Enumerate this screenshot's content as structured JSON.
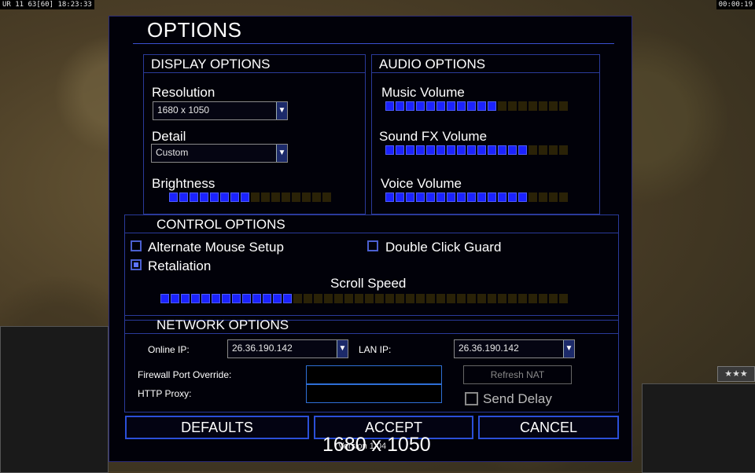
{
  "hud": {
    "top_left": "UR 11 63[60] 18:23:33",
    "top_right": "00:00:19"
  },
  "rank_stars": "★★★",
  "dialog": {
    "title": "OPTIONS"
  },
  "display": {
    "header": "DISPLAY OPTIONS",
    "resolution_label": "Resolution",
    "resolution_value": "1680 x 1050",
    "detail_label": "Detail",
    "detail_value": "Custom",
    "brightness_label": "Brightness",
    "brightness_level": 0.5
  },
  "audio": {
    "header": "AUDIO OPTIONS",
    "music_label": "Music Volume",
    "music_level": 0.6,
    "sfx_label": "Sound FX Volume",
    "sfx_level": 0.8,
    "voice_label": "Voice Volume",
    "voice_level": 0.8
  },
  "control": {
    "header": "CONTROL OPTIONS",
    "alt_mouse_label": "Alternate Mouse Setup",
    "alt_mouse_checked": false,
    "double_click_label": "Double Click Guard",
    "double_click_checked": false,
    "retaliation_label": "Retaliation",
    "retaliation_checked": true,
    "scroll_label": "Scroll Speed",
    "scroll_level": 0.33
  },
  "network": {
    "header": "NETWORK OPTIONS",
    "online_ip_label": "Online IP:",
    "online_ip_value": "26.36.190.142",
    "lan_ip_label": "LAN IP:",
    "lan_ip_value": "26.36.190.142",
    "firewall_label": "Firewall Port Override:",
    "firewall_value": "",
    "proxy_label": "HTTP Proxy:",
    "proxy_value": "",
    "refresh_nat_label": "Refresh NAT",
    "send_delay_label": "Send Delay",
    "send_delay_checked": false
  },
  "buttons": {
    "defaults": "DEFAULTS",
    "accept": "ACCEPT",
    "cancel": "CANCEL"
  },
  "overlay": {
    "resolution_text": "1680 x 1050",
    "version_text": "Version 1.04"
  }
}
